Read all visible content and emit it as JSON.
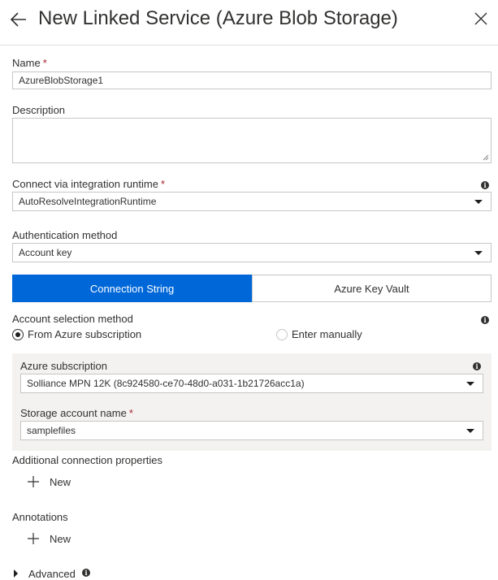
{
  "header": {
    "title": "New Linked Service (Azure Blob Storage)"
  },
  "name": {
    "label": "Name",
    "required": "*",
    "value": "AzureBlobStorage1"
  },
  "description": {
    "label": "Description",
    "value": ""
  },
  "integration_runtime": {
    "label": "Connect via integration runtime",
    "required": "*",
    "value": "AutoResolveIntegrationRuntime"
  },
  "auth_method": {
    "label": "Authentication method",
    "value": "Account key"
  },
  "connection_tabs": {
    "connection_string": "Connection String",
    "key_vault": "Azure Key Vault",
    "active": "connection_string",
    "active_color": "#0067d9"
  },
  "account_selection": {
    "label": "Account selection method",
    "options": [
      "From Azure subscription",
      "Enter manually"
    ],
    "selected": "From Azure subscription"
  },
  "subscription": {
    "label": "Azure subscription",
    "value": "Solliance MPN 12K (8c924580-ce70-48d0-a031-1b21726acc1a)"
  },
  "storage_account": {
    "label": "Storage account name",
    "required": "*",
    "value": "samplefiles"
  },
  "additional_props": {
    "label": "Additional connection properties",
    "new_label": "New"
  },
  "annotations": {
    "label": "Annotations",
    "new_label": "New"
  },
  "advanced": {
    "label": "Advanced"
  },
  "icons": {
    "back": "arrow-left-icon",
    "close": "close-icon",
    "info": "info-icon",
    "plus": "plus-icon",
    "expand": "chevron-right-icon",
    "dropdown": "chevron-down-icon"
  }
}
